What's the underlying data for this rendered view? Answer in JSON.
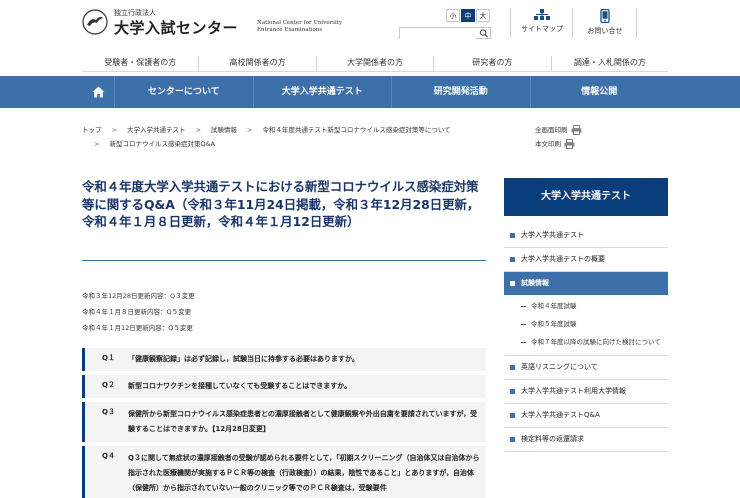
{
  "header": {
    "org_type": "独立行政法人",
    "org_name": "大学入試センター",
    "org_name_en": "National Center for University Entrance Examinations",
    "font_sizes": [
      "小",
      "中",
      "大"
    ],
    "search_placeholder": "",
    "sitemap_label": "サイトマップ",
    "contact_label": "お問い合せ"
  },
  "audience_nav": [
    "受験者・保護者の方",
    "高校関係者の方",
    "大学関係者の方",
    "研究者の方",
    "調達・入札関係の方"
  ],
  "global_nav": [
    "センターについて",
    "大学入学共通テスト",
    "研究開発活動",
    "情報公開"
  ],
  "breadcrumb": {
    "row1": [
      "トップ",
      "大学入学共通テスト",
      "試験情報",
      "令和４年度共通テスト新型コロナウイルス感染症対策等について"
    ],
    "row2": [
      "新型コロナウイルス感染症対策Q&A"
    ]
  },
  "print": {
    "full": "全画面印刷",
    "body": "本文印刷"
  },
  "page_title": "令和４年度大学入学共通テストにおける新型コロナウイルス感染症対策等に関するQ&A（令和３年11月24日掲載，令和３年12月28日更新，令和４年１月８日更新，令和４年１月12日更新）",
  "updates": [
    "令和３年12月28日更新内容：Q３変更",
    "令和４年１月８日更新内容：Q５変更",
    "令和４年１月12日更新内容：Q５変更"
  ],
  "qa": [
    {
      "num": "Q１",
      "text": "「健康観察記録」は必ず記録し，試験当日に持参する必要はありますか。"
    },
    {
      "num": "Q２",
      "text": "新型コロナワクチンを接種していなくても受験することはできますか。"
    },
    {
      "num": "Q３",
      "text": "保健所から新型コロナウイルス感染症患者との濃厚接触者として健康観察や外出自粛を要請されていますが，受験することはできますか。【12月28日変更】"
    },
    {
      "num": "Q４",
      "text": "Q３に関して無症状の濃厚接触者の受験が認められる要件として，「初期スクリーニング（自治体又は自治体から指示された医療機関が実施するＰＣＲ等の検査（行政検査））の結果，陰性であること」とありますが，自治体（保健所）から指示されていない一般のクリニック等でのＰＣＲ検査は，受験要件"
    }
  ],
  "sidebar": {
    "title": "大学入学共通テスト",
    "items": [
      {
        "label": "大学入学共通テスト"
      },
      {
        "label": "大学入学共通テストの概要"
      },
      {
        "label": "試験情報",
        "active": true,
        "children": [
          "令和４年度試験",
          "令和５年度試験",
          "令和７年度以降の試験に向けた検討について"
        ]
      },
      {
        "label": "英語リスニングについて"
      },
      {
        "label": "大学入学共通テスト利用大学情報"
      },
      {
        "label": "大学入学共通テストQ&A"
      },
      {
        "label": "検定料等の返還請求"
      }
    ]
  },
  "colors": {
    "nav_blue": "#3d6fa8",
    "dark_navy": "#0a3d7c",
    "title_navy": "#1a3668"
  }
}
